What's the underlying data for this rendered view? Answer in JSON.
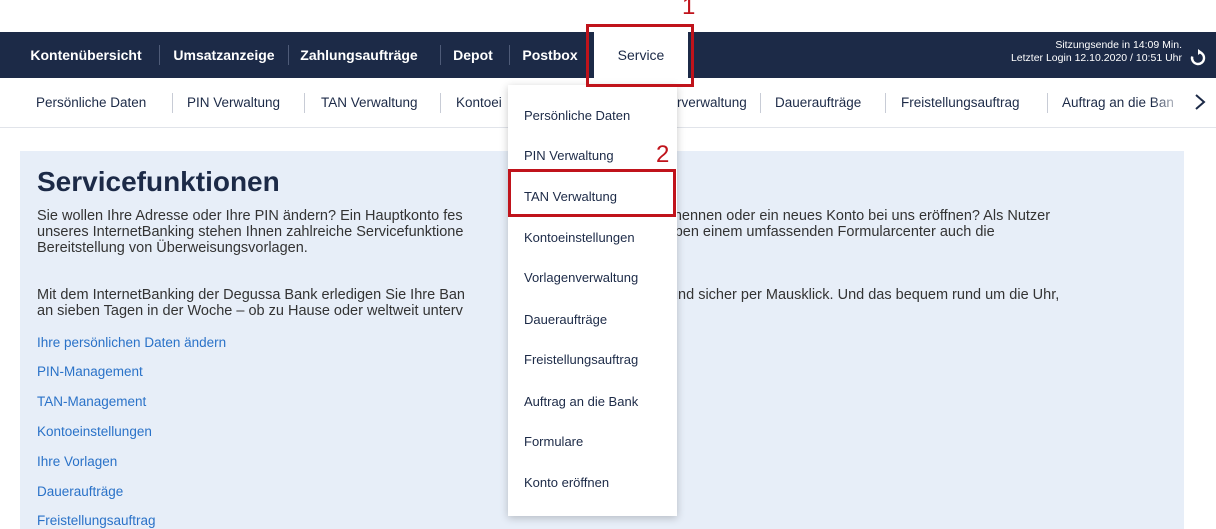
{
  "top_nav": {
    "items": [
      "Kontenübersicht",
      "Umsatzanzeige",
      "Zahlungsaufträge",
      "Depot",
      "Postbox",
      "Service"
    ],
    "active": "Service"
  },
  "session": {
    "line1": "Sitzungsende in 14:09 Min.",
    "line2": "Letzter Login 12.10.2020 / 10:51 Uhr"
  },
  "sub_nav": {
    "items": [
      "Persönliche Daten",
      "PIN Verwaltung",
      "TAN Verwaltung",
      "Kontoei",
      "rverwaltung",
      "Daueraufträge",
      "Freistellungsauftrag",
      "Auftrag an die Ban"
    ]
  },
  "main": {
    "title": "Servicefunktionen",
    "para1_line1": "Sie wollen Ihre Adresse oder Ihre PIN ändern? Ein Hauptkonto fes",
    "para1_line1b": "viduell benennen oder ein neues Konto bei uns eröffnen? Als Nutzer",
    "para1_line2": "unseres InternetBanking stehen Ihnen zahlreiche Servicefunktione",
    "para1_line2b": "gehört neben einem umfassenden Formularcenter auch die",
    "para1_line3": "Bereitstellung von Überweisungsvorlagen.",
    "para2_line1": "Mit dem InternetBanking der Degussa Bank erledigen Sie Ihre Ban",
    "para2_line1b": "stenlos und sicher per Mausklick. Und das bequem rund um die Uhr,",
    "para2_line2": "an sieben Tagen in der Woche – ob zu Hause oder weltweit unterv",
    "links": [
      "Ihre persönlichen Daten ändern",
      "PIN-Management",
      "TAN-Management",
      "Kontoeinstellungen",
      "Ihre Vorlagen",
      "Daueraufträge",
      "Freistellungsauftrag"
    ]
  },
  "dropdown": {
    "items": [
      "Persönliche Daten",
      "PIN Verwaltung",
      "TAN Verwaltung",
      "Kontoeinstellungen",
      "Vorlagenverwaltung",
      "Daueraufträge",
      "Freistellungsauftrag",
      "Auftrag an die Bank",
      "Formulare",
      "Konto eröffnen"
    ]
  },
  "annotations": {
    "marker1": "1",
    "marker2": "2",
    "color": "#c0131b"
  },
  "colors": {
    "nav_bg": "#1c2a47",
    "link": "#2a72c8",
    "panel_bg": "#e7eef8"
  }
}
